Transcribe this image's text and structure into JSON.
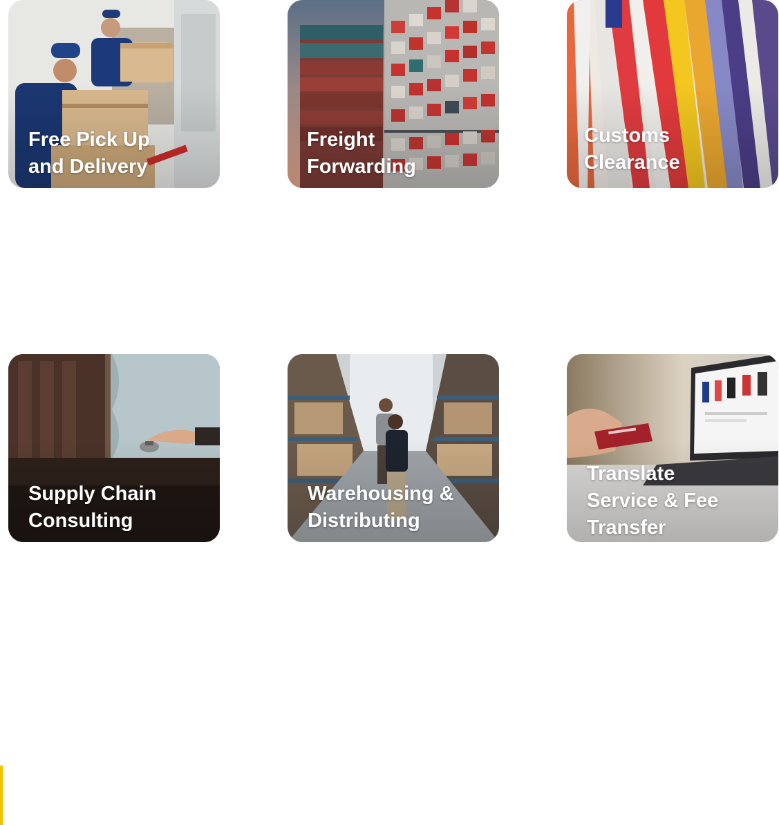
{
  "services": [
    {
      "title": "Free Pick Up\nand Delivery"
    },
    {
      "title": "Freight\nForwarding"
    },
    {
      "title": "Customs\nClearance"
    },
    {
      "title": "Supply Chain\nConsulting"
    },
    {
      "title": "Warehousing &\nDistributing"
    },
    {
      "title": "Translate\nService & Fee\nTransfer"
    }
  ],
  "colors": {
    "accent": "#f2c300",
    "card_text": "#ffffff"
  }
}
